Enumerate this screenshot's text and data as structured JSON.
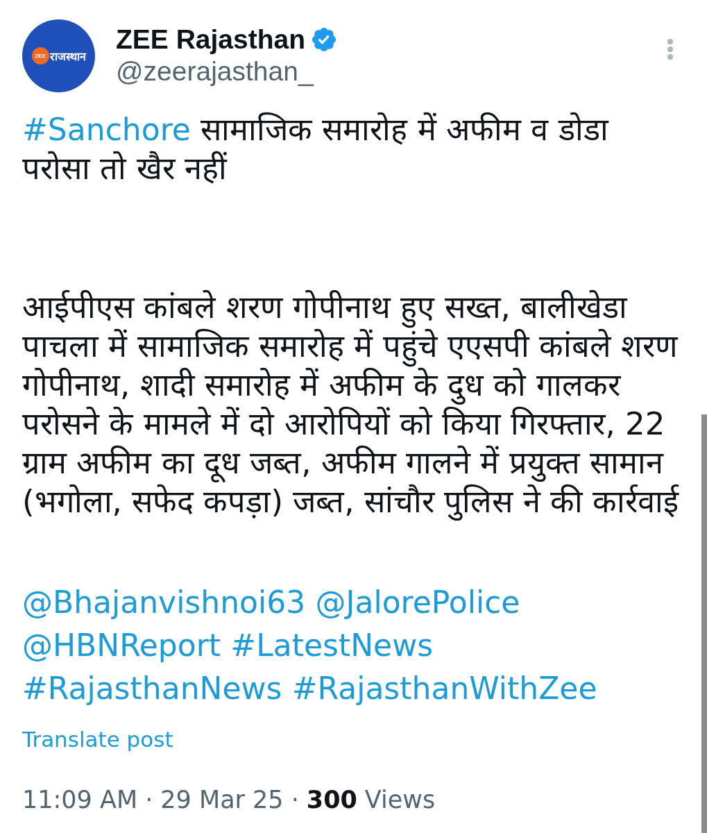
{
  "author": {
    "avatar": {
      "logo_mark": "ZEE",
      "logo_text": "राजस्थान"
    },
    "name": "ZEE Rajasthan",
    "verified": true,
    "handle": "@zeerajasthan_"
  },
  "post": {
    "paragraphs": [
      {
        "kind": "text",
        "lines": [
          [
            {
              "kind": "hashtag",
              "text": "#Sanchore"
            },
            {
              "kind": "text",
              "text": "सामाजिक समारोह में अफीम व डोडा"
            }
          ],
          [
            {
              "kind": "text",
              "text": "परोसा तो खैर नहीं"
            }
          ]
        ]
      },
      {
        "kind": "text",
        "lines": [
          [
            {
              "kind": "text",
              "text": "आईपीएस कांबले शरण गोपीनाथ हुए सख्त, बालीखेडा"
            }
          ],
          [
            {
              "kind": "text",
              "text": "पाचला में सामाजिक समारोह में पहुंचे एएसपी कांबले शरण"
            }
          ],
          [
            {
              "kind": "text",
              "text": "गोपीनाथ, शादी समारोह में अफीम के दुध को गालकर"
            }
          ],
          [
            {
              "kind": "text",
              "text": "परोसने के मामले में दो आरोपियों को किया गिरफ्तार, 22"
            }
          ],
          [
            {
              "kind": "text",
              "text": "ग्राम अफीम का दूध जब्त, अफीम गालने में प्रयुक्त सामान"
            }
          ],
          [
            {
              "kind": "text",
              "text": "(भगोला, सफेद कपड़ा) जब्त, सांचौर पुलिस ने की कार्रवाई"
            }
          ]
        ]
      },
      {
        "kind": "links",
        "lines": [
          [
            {
              "kind": "mention",
              "text": "@Bhajanvishnoi63"
            },
            {
              "kind": "mention",
              "text": "@JalorePolice"
            }
          ],
          [
            {
              "kind": "mention",
              "text": "@HBNReport"
            },
            {
              "kind": "hashtag",
              "text": "#LatestNews"
            }
          ],
          [
            {
              "kind": "hashtag",
              "text": "#RajasthanNews"
            },
            {
              "kind": "hashtag",
              "text": "#RajasthanWithZee"
            }
          ]
        ]
      }
    ]
  },
  "translate_link": "Translate post",
  "meta": {
    "time": "11:09 AM",
    "separator_1": "·",
    "date": "29 Mar 25",
    "separator_2": "·",
    "views_count": "300",
    "views_label": "Views"
  }
}
